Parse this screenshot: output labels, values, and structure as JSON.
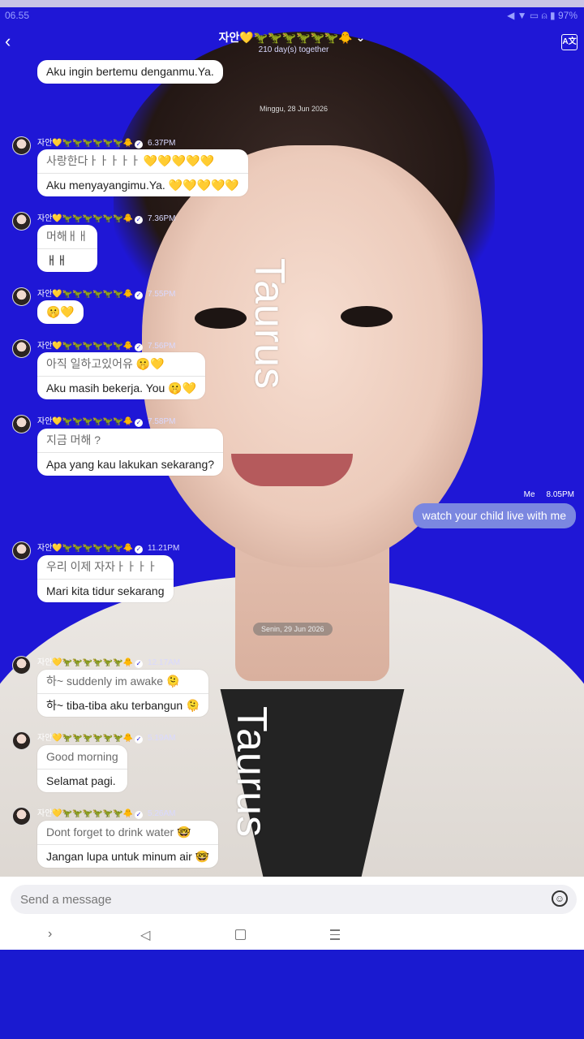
{
  "status": {
    "time": "06.55",
    "icons": "◀ ▼ ▭ ⍝ ▮ 97%"
  },
  "header": {
    "back": "‹",
    "title": "자안💛🦖🦖🦖🦖🦖🦖🐥 ⌄",
    "subtitle": "210 day(s) together",
    "translate": "A文"
  },
  "watermark": "Taurus",
  "first_bubble": "Aku ingin bertemu denganmu.Ya.",
  "dates": {
    "d1": "Minggu, 28 Jun 2026",
    "d2": "Senin, 29 Jun 2026"
  },
  "sender_name": "자안💛🦖🦖🦖🦖🦖🦖🐥",
  "messages": [
    {
      "time": "6.37PM",
      "orig": "사랑한다ㅏㅏㅏㅏㅏ 💛💛💛💛💛",
      "trans": "Aku menyayangimu.Ya. 💛💛💛💛💛"
    },
    {
      "time": "7.36PM",
      "orig": "머해ㅐㅐ",
      "trans": "ㅐㅐ"
    },
    {
      "time": "7.55PM",
      "orig": "🤫💛"
    },
    {
      "time": "7.56PM",
      "orig": "아직 일하고있어유 🤫💛",
      "trans": "Aku masih bekerja. You 🤫💛"
    },
    {
      "time": "7.58PM",
      "orig": "지금 머해 ?",
      "trans": "Apa yang kau lakukan sekarang?"
    },
    {
      "time": "11.21PM",
      "orig": "우리 이제 자자ㅏㅏㅏㅏ",
      "trans": "Mari kita tidur sekarang"
    },
    {
      "time": "12.17AM",
      "orig": "하~ suddenly im awake 🫠",
      "trans": "하~ tiba-tiba aku terbangun 🫠"
    },
    {
      "time": "5.19AM",
      "orig": "Good morning",
      "trans": "Selamat pagi."
    },
    {
      "time": "5.26AM",
      "orig": "Dont forget to drink water 🤓",
      "trans": "Jangan lupa untuk minum air 🤓"
    }
  ],
  "me": {
    "label": "Me",
    "time": "8.05PM",
    "text": "watch your child live with me"
  },
  "composer": {
    "placeholder": "Send a message",
    "emoji": "☺"
  },
  "nav": {
    "forward": "›",
    "back": "◁"
  }
}
